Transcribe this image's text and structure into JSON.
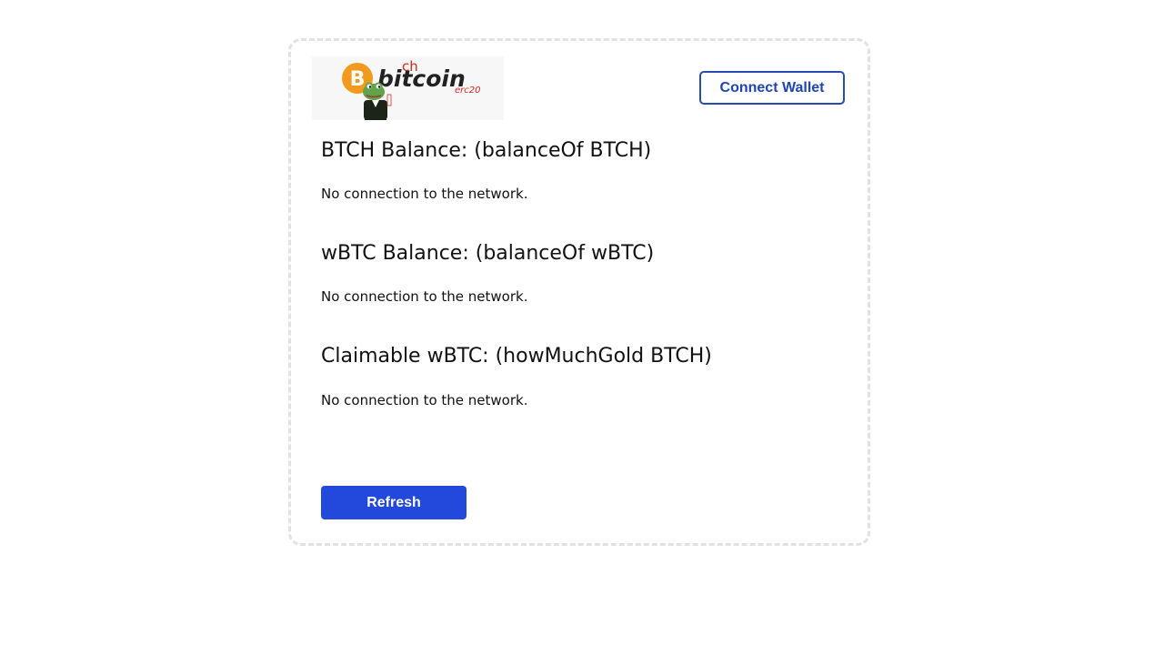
{
  "header": {
    "logo": {
      "wordmark": "bitcoin",
      "superscript": "ch",
      "suffix": "erc20",
      "coin_symbol": "B",
      "colors": {
        "coin": "#f29a1f",
        "accent": "#d9261c",
        "frog": "#5fa34a",
        "suit": "#1c2418"
      }
    },
    "connect_wallet_label": "Connect Wallet"
  },
  "sections": [
    {
      "title": "BTCH Balance: (balanceOf BTCH)",
      "status": "No connection to the network."
    },
    {
      "title": "wBTC Balance: (balanceOf wBTC)",
      "status": "No connection to the network."
    },
    {
      "title": "Claimable wBTC: (howMuchGold BTCH)",
      "status": "No connection to the network."
    }
  ],
  "refresh_label": "Refresh",
  "colors": {
    "primary": "#2349dc",
    "outline_button": "#2a4bb3",
    "card_border": "#e2e2e2"
  }
}
